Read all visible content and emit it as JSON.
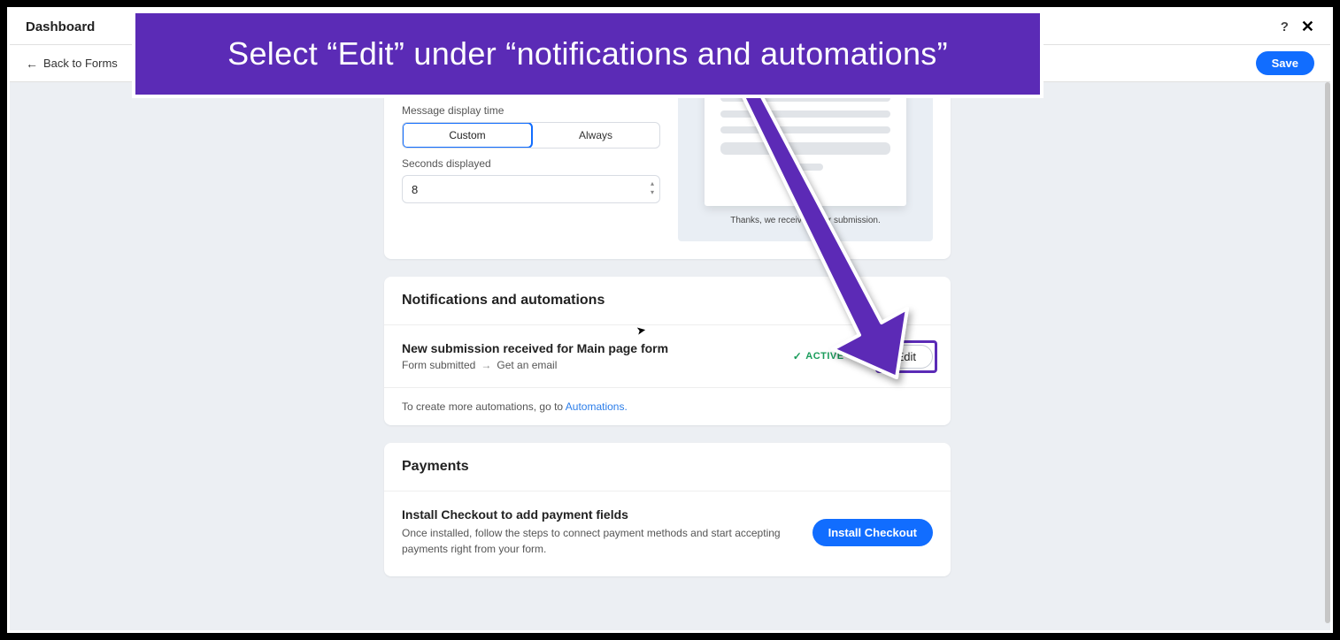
{
  "topbar": {
    "title": "Dashboard"
  },
  "subbar": {
    "back": "Back to Forms",
    "save": "Save"
  },
  "messageSection": {
    "displayTimeLabel": "Message display time",
    "custom": "Custom",
    "always": "Always",
    "secondsLabel": "Seconds displayed",
    "secondsValue": "8",
    "previewThanks": "Thanks, we received your submission."
  },
  "notifications": {
    "heading": "Notifications and automations",
    "itemTitle": "New submission received for Main page form",
    "trigger": "Form submitted",
    "action": "Get an email",
    "status": "ACTIVE",
    "edit": "Edit",
    "footerPrefix": "To create more automations, go to ",
    "footerLink": "Automations."
  },
  "payments": {
    "heading": "Payments",
    "title": "Install Checkout to add payment fields",
    "desc": "Once installed, follow the steps to connect payment methods and start accepting payments right from your form.",
    "button": "Install Checkout"
  },
  "banner": {
    "text": "Select “Edit” under “notifications and automations”"
  },
  "icons": {
    "help": "?",
    "close": "✕",
    "back": "←",
    "check": "✓",
    "arrow": "→"
  }
}
